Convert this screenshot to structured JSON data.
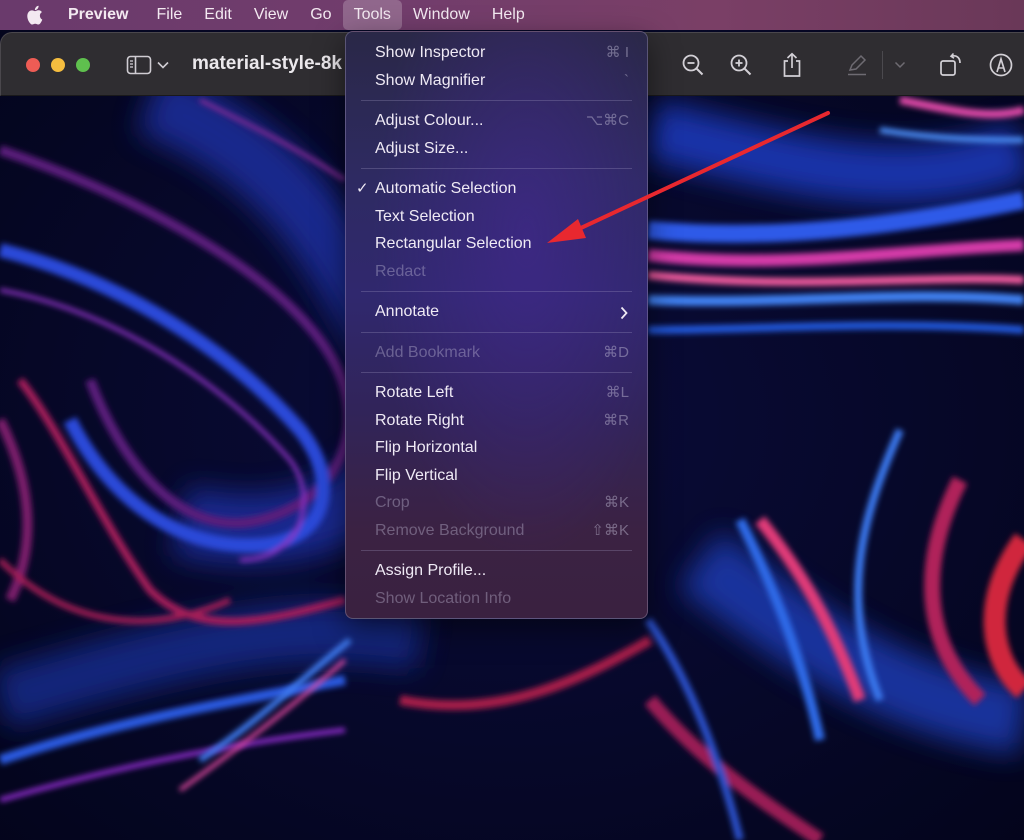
{
  "menubar": {
    "apple_icon": "apple-logo-icon",
    "items": [
      {
        "label": "Preview",
        "app": true
      },
      {
        "label": "File"
      },
      {
        "label": "Edit"
      },
      {
        "label": "View"
      },
      {
        "label": "Go"
      },
      {
        "label": "Tools",
        "active": true
      },
      {
        "label": "Window"
      },
      {
        "label": "Help"
      }
    ]
  },
  "toolbar": {
    "document_title": "material-style-8k",
    "icons": {
      "sidebar": "sidebar-toggle-icon",
      "sidebar_menu": "chevron-down-icon",
      "zoom_out": "zoom-out-icon",
      "zoom_in": "zoom-in-icon",
      "share": "share-icon",
      "highlight": "highlight-pen-icon",
      "highlight_menu": "chevron-down-icon",
      "rotate": "rotate-icon",
      "markup": "markup-icon"
    }
  },
  "tools_menu": {
    "groups": [
      [
        {
          "label": "Show Inspector",
          "shortcut": "⌘ I",
          "enabled": true
        },
        {
          "label": "Show Magnifier",
          "shortcut": "`",
          "enabled": true
        }
      ],
      [
        {
          "label": "Adjust Colour...",
          "shortcut": "⌥⌘C",
          "enabled": true
        },
        {
          "label": "Adjust Size...",
          "shortcut": "",
          "enabled": true
        }
      ],
      [
        {
          "label": "Automatic Selection",
          "shortcut": "",
          "enabled": true,
          "checked": true
        },
        {
          "label": "Text Selection",
          "shortcut": "",
          "enabled": true
        },
        {
          "label": "Rectangular Selection",
          "shortcut": "",
          "enabled": true
        },
        {
          "label": "Redact",
          "shortcut": "",
          "enabled": false
        }
      ],
      [
        {
          "label": "Annotate",
          "shortcut": "",
          "enabled": true,
          "submenu": true
        }
      ],
      [
        {
          "label": "Add Bookmark",
          "shortcut": "⌘D",
          "enabled": false
        }
      ],
      [
        {
          "label": "Rotate Left",
          "shortcut": "⌘L",
          "enabled": true
        },
        {
          "label": "Rotate Right",
          "shortcut": "⌘R",
          "enabled": true
        },
        {
          "label": "Flip Horizontal",
          "shortcut": "",
          "enabled": true
        },
        {
          "label": "Flip Vertical",
          "shortcut": "",
          "enabled": true
        },
        {
          "label": "Crop",
          "shortcut": "⌘K",
          "enabled": false
        },
        {
          "label": "Remove Background",
          "shortcut": "⇧⌘K",
          "enabled": false
        }
      ],
      [
        {
          "label": "Assign Profile...",
          "shortcut": "",
          "enabled": true
        },
        {
          "label": "Show Location Info",
          "shortcut": "",
          "enabled": false
        }
      ]
    ],
    "check_glyph": "✓",
    "submenu_glyph": "›"
  },
  "annotation": {
    "type": "arrow",
    "color": "#e8282f",
    "points_to": "Rectangular Selection"
  },
  "colors": {
    "traffic_close": "#ee5c55",
    "traffic_minimize": "#f5bd3f",
    "traffic_maximize": "#5fc04e"
  }
}
